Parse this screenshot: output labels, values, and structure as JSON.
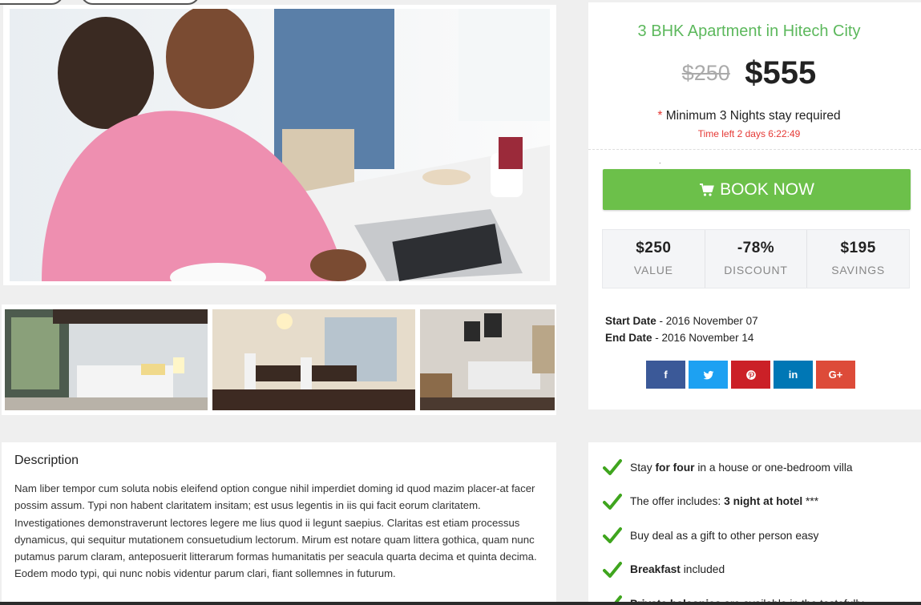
{
  "deal": {
    "title": "3 BHK Apartment in Hitech City",
    "old_price": "$250",
    "new_price": "$555",
    "min_stay_star": "*",
    "min_stay": "Minimum 3 Nights stay required",
    "time_left": "Time left 2 days 6:22:49",
    "dot": ".",
    "book_label": "BOOK NOW",
    "stats": [
      {
        "value": "$250",
        "label": "VALUE"
      },
      {
        "value": "-78%",
        "label": "DISCOUNT"
      },
      {
        "value": "$195",
        "label": "SAVINGS"
      }
    ],
    "start_label": "Start Date",
    "start_value": " - 2016 November 07",
    "end_label": "End Date",
    "end_value": " - 2016 November 14",
    "social": [
      {
        "name": "facebook",
        "glyph": "f",
        "color": "#3b5998"
      },
      {
        "name": "twitter",
        "glyph": "",
        "color": "#1da1f2"
      },
      {
        "name": "pinterest",
        "glyph": "",
        "color": "#cb2027"
      },
      {
        "name": "linkedin",
        "glyph": "in",
        "color": "#0077b5"
      },
      {
        "name": "google-plus",
        "glyph": "G+",
        "color": "#dd4b39"
      }
    ]
  },
  "description": {
    "heading": "Description",
    "text": "Nam liber tempor cum soluta nobis eleifend option congue nihil imperdiet doming id quod mazim placer-at facer possim assum. Typi non habent claritatem insitam; est usus legentis in iis qui facit eorum claritatem. Investigationes demonstraverunt lectores legere me lius quod ii legunt saepius. Claritas est etiam processus dynamicus, qui sequitur mutationem consuetudium lectorum. Mirum est notare quam littera gothica, quam nunc putamus parum claram, anteposuerit litterarum formas humanitatis per seacula quarta decima et quinta decima. Eodem modo typi, qui nunc nobis videntur parum clari, fiant sollemnes in futurum."
  },
  "features": [
    {
      "pre": "Stay ",
      "bold": "for four",
      "post": " in a house or one-bedroom villa"
    },
    {
      "pre": "The offer includes: ",
      "bold": "3 night at hotel",
      "post": " ***"
    },
    {
      "pre": "Buy deal as a gift to other person easy",
      "bold": "",
      "post": ""
    },
    {
      "pre": "",
      "bold": "Breakfast",
      "post": " included"
    },
    {
      "pre": "",
      "bold": "Private balconies",
      "post": " are available in the tastefully"
    }
  ],
  "colors": {
    "accent_green": "#6cc04a",
    "title_green": "#5cb85c",
    "alert_red": "#e53935"
  }
}
